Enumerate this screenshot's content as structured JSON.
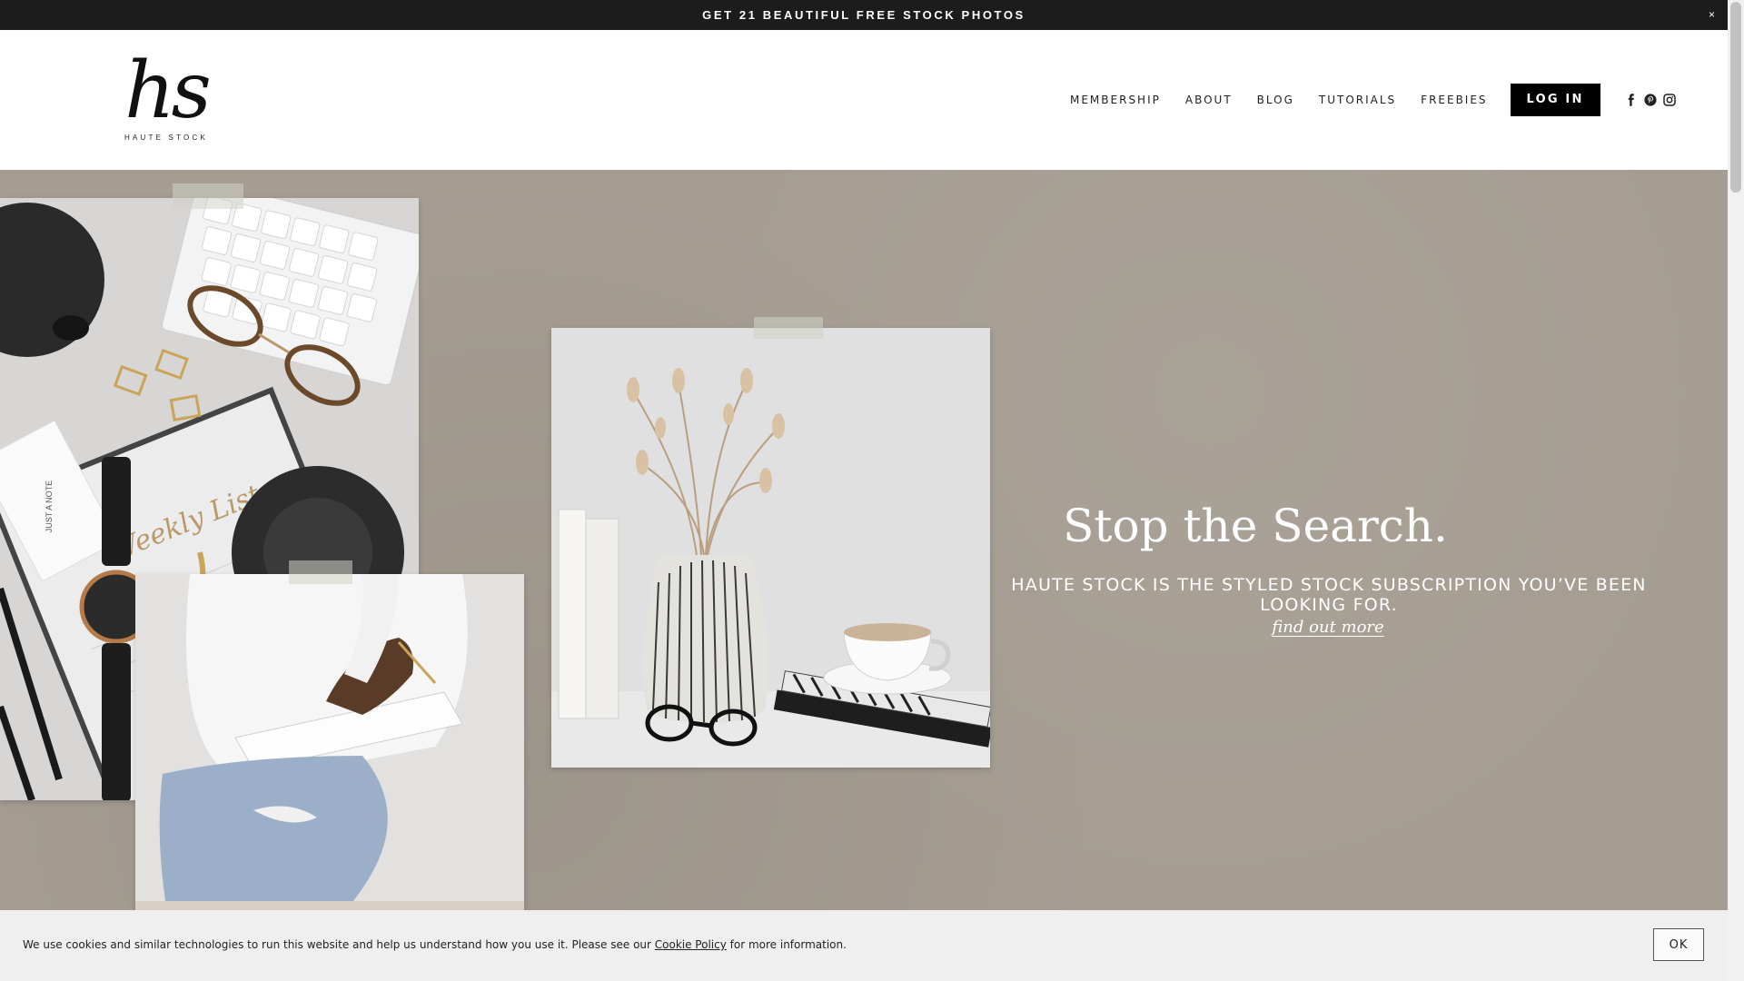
{
  "announcement": {
    "text": "GET 21 BEAUTIFUL FREE STOCK PHOTOS",
    "close": "×"
  },
  "header": {
    "logo_mark": "hs",
    "logo_text": "HAUTE STOCK",
    "nav": [
      {
        "label": "MEMBERSHIP"
      },
      {
        "label": "ABOUT"
      },
      {
        "label": "BLOG"
      },
      {
        "label": "TUTORIALS"
      },
      {
        "label": "FREEBIES"
      }
    ],
    "login_label": "LOG IN",
    "social_icons": [
      "facebook-icon",
      "pinterest-icon",
      "instagram-icon"
    ]
  },
  "hero": {
    "title": "Stop the Search.",
    "subtitle": "HAUTE STOCK IS THE STYLED STOCK SUBSCRIPTION YOU’VE BEEN LOOKING FOR.",
    "cta": "find out more",
    "background_color": "#a59d92"
  },
  "cookie_banner": {
    "text_before": "We use cookies and similar technologies to run this website and help us understand how you use it. Please see our ",
    "link": "Cookie Policy",
    "text_after": " for more information.",
    "ok_label": "OK"
  }
}
